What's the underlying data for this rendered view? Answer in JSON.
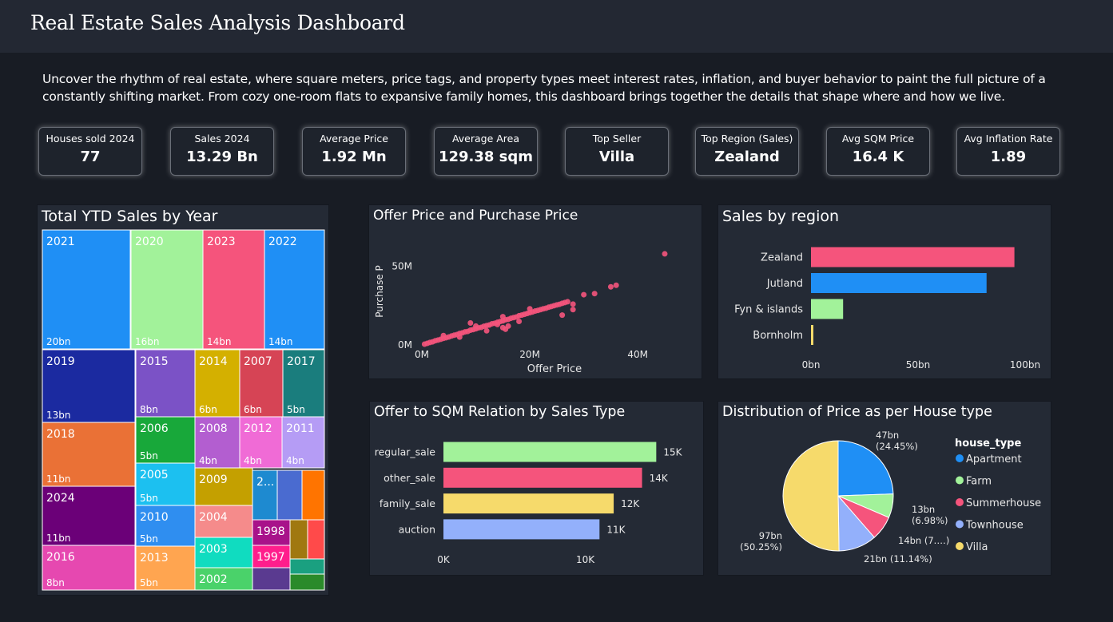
{
  "header": {
    "title": "Real Estate Sales Analysis Dashboard"
  },
  "intro": "Uncover the rhythm of real estate, where square meters, price tags, and property types meet interest rates, inflation, and buyer behavior to paint the full picture of a constantly shifting market. From cozy one-room flats to expansive family homes, this dashboard brings together the details that shape where and how we live.",
  "kpis": [
    {
      "label": "Houses sold 2024",
      "value": "77"
    },
    {
      "label": "Sales 2024",
      "value": "13.29 Bn"
    },
    {
      "label": "Average Price",
      "value": "1.92 Mn"
    },
    {
      "label": "Average Area",
      "value": "129.38 sqm"
    },
    {
      "label": "Top Seller",
      "value": "Villa"
    },
    {
      "label": "Top Region (Sales)",
      "value": "Zealand"
    },
    {
      "label": "Avg SQM Price",
      "value": "16.4 K"
    },
    {
      "label": "Avg Inflation Rate",
      "value": "1.89"
    }
  ],
  "chart_data": [
    {
      "type": "treemap",
      "title": "Total YTD Sales by Year",
      "items": [
        {
          "label": "2021",
          "value": "20bn",
          "color": "#1f8ff5"
        },
        {
          "label": "2020",
          "value": "16bn",
          "color": "#a2f29a"
        },
        {
          "label": "2023",
          "value": "14bn",
          "color": "#f5547c"
        },
        {
          "label": "2022",
          "value": "14bn",
          "color": "#1f8ff5"
        },
        {
          "label": "2019",
          "value": "13bn",
          "color": "#1b2aa0"
        },
        {
          "label": "2015",
          "value": "8bn",
          "color": "#7b52c6"
        },
        {
          "label": "2014",
          "value": "6bn",
          "color": "#d4b000"
        },
        {
          "label": "2007",
          "value": "6bn",
          "color": "#d64455"
        },
        {
          "label": "2017",
          "value": "5bn",
          "color": "#1a7d7d"
        },
        {
          "label": "2018",
          "value": "11bn",
          "color": "#ea7136"
        },
        {
          "label": "2006",
          "value": "5bn",
          "color": "#18a83a"
        },
        {
          "label": "2008",
          "value": "4bn",
          "color": "#b35ed0"
        },
        {
          "label": "2012",
          "value": "4bn",
          "color": "#f06bd6"
        },
        {
          "label": "2011",
          "value": "4bn",
          "color": "#b59cf5"
        },
        {
          "label": "2005",
          "value": "5bn",
          "color": "#1cc0f0"
        },
        {
          "label": "2009",
          "value": "",
          "color": "#c4a000"
        },
        {
          "label": "2024",
          "value": "11bn",
          "color": "#6b0078"
        },
        {
          "label": "2010",
          "value": "5bn",
          "color": "#2f8ef0"
        },
        {
          "label": "2004",
          "value": "",
          "color": "#f58b8b"
        },
        {
          "label": "2...",
          "value": "",
          "color": "#1e8ad0"
        },
        {
          "label": "1998",
          "value": "",
          "color": "#a8128a"
        },
        {
          "label": "2003",
          "value": "",
          "color": "#10dcc0"
        },
        {
          "label": "2016",
          "value": "8bn",
          "color": "#e648b0"
        },
        {
          "label": "2013",
          "value": "5bn",
          "color": "#ffa550"
        },
        {
          "label": "1997",
          "value": "",
          "color": "#ff1e8c"
        },
        {
          "label": "2002",
          "value": "",
          "color": "#4ad26a"
        }
      ]
    },
    {
      "type": "scatter",
      "title": "Offer Price and Purchase Price",
      "xlabel": "Offer Price",
      "ylabel": "Purchase P",
      "xticks": [
        "0M",
        "20M",
        "40M"
      ],
      "yticks": [
        "0M",
        "50M"
      ],
      "xlim": [
        0,
        45
      ],
      "ylim": [
        0,
        60
      ],
      "color": "#f5547c",
      "points": [
        [
          0.5,
          0.5
        ],
        [
          1,
          1
        ],
        [
          1.5,
          1.6
        ],
        [
          2,
          2
        ],
        [
          2.5,
          2.7
        ],
        [
          3,
          3.1
        ],
        [
          3.5,
          3.6
        ],
        [
          4,
          4.2
        ],
        [
          4.5,
          4.6
        ],
        [
          5,
          5.1
        ],
        [
          5.5,
          5.7
        ],
        [
          6,
          6.2
        ],
        [
          6.5,
          6.6
        ],
        [
          7,
          7.3
        ],
        [
          7.5,
          7.7
        ],
        [
          8,
          8.3
        ],
        [
          8.5,
          8.6
        ],
        [
          9,
          9.4
        ],
        [
          9.5,
          9.8
        ],
        [
          10,
          10.3
        ],
        [
          10.5,
          10.9
        ],
        [
          11,
          11.2
        ],
        [
          11.5,
          11.9
        ],
        [
          12,
          12.3
        ],
        [
          12.5,
          12.7
        ],
        [
          13,
          13.5
        ],
        [
          13.5,
          13.8
        ],
        [
          14,
          14.4
        ],
        [
          14.5,
          14.9
        ],
        [
          15,
          15.3
        ],
        [
          15.5,
          16
        ],
        [
          16,
          16.3
        ],
        [
          16.5,
          17
        ],
        [
          17,
          17.4
        ],
        [
          17.5,
          17.8
        ],
        [
          18,
          18.6
        ],
        [
          18.5,
          19
        ],
        [
          19,
          19.5
        ],
        [
          19.5,
          20
        ],
        [
          20,
          20.5
        ],
        [
          20.5,
          21
        ],
        [
          21,
          21.6
        ],
        [
          21.5,
          22
        ],
        [
          22,
          22.5
        ],
        [
          22.5,
          23
        ],
        [
          23,
          23.4
        ],
        [
          23.5,
          24
        ],
        [
          24,
          24.5
        ],
        [
          24.5,
          25
        ],
        [
          25,
          25.5
        ],
        [
          25.5,
          25.9
        ],
        [
          26,
          26.5
        ],
        [
          26.5,
          27
        ],
        [
          27,
          27.5
        ],
        [
          4,
          6
        ],
        [
          7,
          5
        ],
        [
          10,
          12
        ],
        [
          12,
          9
        ],
        [
          15,
          18
        ],
        [
          15,
          11
        ],
        [
          15.5,
          10
        ],
        [
          16,
          12
        ],
        [
          18,
          15
        ],
        [
          14,
          13
        ],
        [
          20,
          23
        ],
        [
          9,
          14
        ],
        [
          28,
          26
        ],
        [
          28,
          22.5
        ],
        [
          26,
          19
        ],
        [
          30,
          32
        ],
        [
          32,
          32.7
        ],
        [
          35,
          37
        ],
        [
          36,
          38
        ],
        [
          45,
          58
        ]
      ]
    },
    {
      "type": "bar",
      "title": "Sales by region",
      "categories": [
        "Zealand",
        "Jutland",
        "Fyn & islands",
        "Bornholm"
      ],
      "values": [
        95,
        82,
        15,
        1
      ],
      "colors": [
        "#f5547c",
        "#1f8ff5",
        "#a2f29a",
        "#f6da6b"
      ],
      "xticks": [
        "0bn",
        "50bn",
        "100bn"
      ],
      "xlim": [
        0,
        100
      ]
    },
    {
      "type": "bar",
      "title": "Offer to SQM Relation by Sales Type",
      "categories": [
        "regular_sale",
        "other_sale",
        "family_sale",
        "auction"
      ],
      "values": [
        15,
        14,
        12,
        11
      ],
      "labels": [
        "15K",
        "14K",
        "12K",
        "11K"
      ],
      "colors": [
        "#a2f29a",
        "#f5547c",
        "#f6da6b",
        "#93b0fb"
      ],
      "xticks": [
        "0K",
        "10K"
      ],
      "xlim": [
        0,
        15.6
      ]
    },
    {
      "type": "pie",
      "title": "Distribution of Price as per House type",
      "legend_title": "house_type",
      "slices": [
        {
          "name": "Apartment",
          "value": 24.45,
          "label1": "47bn",
          "label2": "(24.45%)",
          "color": "#1f8ff5"
        },
        {
          "name": "Farm",
          "value": 6.98,
          "label1": "13bn",
          "label2": "(6.98%)",
          "color": "#a2f29a"
        },
        {
          "name": "Summerhouse",
          "value": 7.18,
          "label1": "14bn (7.…)",
          "label2": "",
          "color": "#f5547c"
        },
        {
          "name": "Townhouse",
          "value": 11.14,
          "label1": "21bn (11.14%)",
          "label2": "",
          "color": "#93b0fb"
        },
        {
          "name": "Villa",
          "value": 50.25,
          "label1": "97bn",
          "label2": "(50.25%)",
          "color": "#f6da6b"
        }
      ]
    }
  ]
}
